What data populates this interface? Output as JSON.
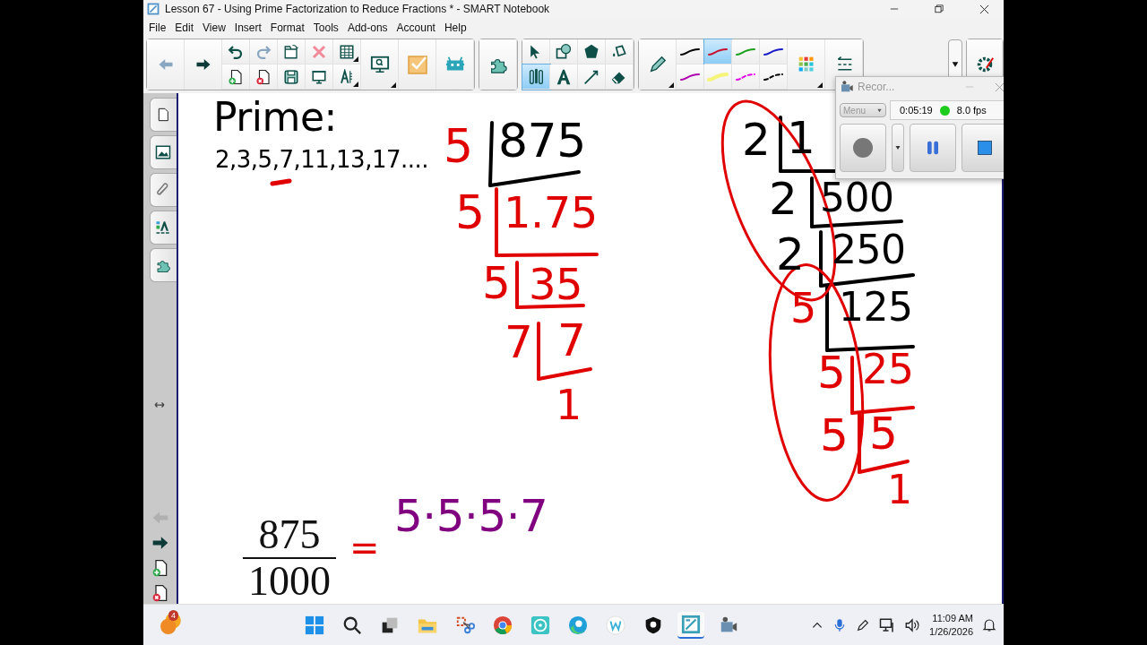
{
  "window": {
    "title": "Lesson 67 - Using Prime Factorization to Reduce Fractions * - SMART Notebook"
  },
  "menu": [
    "File",
    "Edit",
    "View",
    "Insert",
    "Format",
    "Tools",
    "Add-ons",
    "Account",
    "Help"
  ],
  "tools": [
    {
      "kind": "select",
      "selected": false
    },
    {
      "kind": "shapes",
      "selected": false
    },
    {
      "kind": "polygon",
      "selected": false
    },
    {
      "kind": "fill",
      "selected": false
    },
    {
      "kind": "pens",
      "selected": true
    },
    {
      "kind": "text",
      "selected": false
    },
    {
      "kind": "line",
      "selected": false
    },
    {
      "kind": "eraser",
      "selected": false
    }
  ],
  "pens": [
    {
      "kind": "solid",
      "color": "#000000",
      "selected": false
    },
    {
      "kind": "solid",
      "color": "#c8102e",
      "selected": true
    },
    {
      "kind": "solid",
      "color": "#1aa01a",
      "selected": false
    },
    {
      "kind": "solid",
      "color": "#1a1ac8",
      "selected": false
    },
    {
      "kind": "solid",
      "color": "#b000b0",
      "selected": false
    },
    {
      "kind": "highlighter",
      "color": "#f5f57a",
      "selected": false
    },
    {
      "kind": "dashed",
      "color": "#e000e0",
      "selected": false
    },
    {
      "kind": "dashed",
      "color": "#000000",
      "selected": false
    }
  ],
  "ink": [
    {
      "text": "Prime:",
      "color": "#000000"
    },
    {
      "text": "2,3,5,7,11,13,17....",
      "color": "#000000"
    },
    {
      "text": "5",
      "color": "#e00000"
    },
    {
      "text": "875",
      "color": "#000000"
    },
    {
      "text": "5",
      "color": "#e00000"
    },
    {
      "text": "1.75",
      "color": "#e00000"
    },
    {
      "text": "5",
      "color": "#e00000"
    },
    {
      "text": "35",
      "color": "#e00000"
    },
    {
      "text": "7",
      "color": "#e00000"
    },
    {
      "text": "7",
      "color": "#e00000"
    },
    {
      "text": "1",
      "color": "#e00000"
    },
    {
      "text": "2",
      "color": "#000000"
    },
    {
      "text": "1",
      "color": "#000000"
    },
    {
      "text": "2",
      "color": "#000000"
    },
    {
      "text": "500",
      "color": "#000000"
    },
    {
      "text": "2",
      "color": "#000000"
    },
    {
      "text": "250",
      "color": "#000000"
    },
    {
      "text": "5",
      "color": "#e00000"
    },
    {
      "text": "125",
      "color": "#000000"
    },
    {
      "text": "5",
      "color": "#e00000"
    },
    {
      "text": "25",
      "color": "#e00000"
    },
    {
      "text": "5",
      "color": "#e00000"
    },
    {
      "text": "5",
      "color": "#e00000"
    },
    {
      "text": "1",
      "color": "#e00000"
    },
    {
      "text": "=",
      "color": "#e00000"
    },
    {
      "text": "5·5·5·7",
      "color": "#800080"
    }
  ],
  "fraction": {
    "numerator": "875",
    "denominator": "1000"
  },
  "recorder": {
    "title": "Recor...",
    "menu": "Menu",
    "time": "0:05:19",
    "fps": "8.0 fps"
  },
  "taskbar": {
    "badge": "4",
    "time": "11:09 AM",
    "date": "1/26/2026"
  }
}
